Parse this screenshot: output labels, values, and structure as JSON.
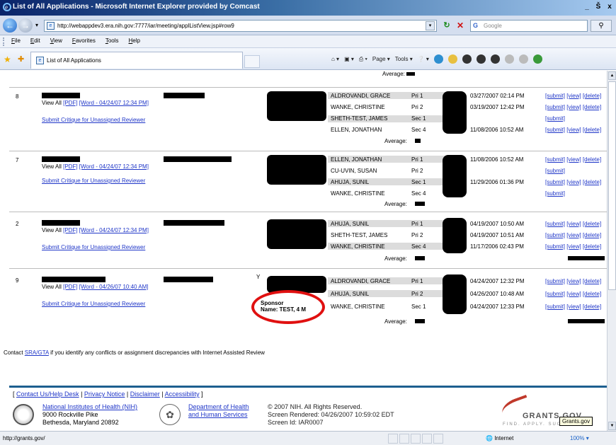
{
  "window": {
    "title": "List of All Applications - Microsoft Internet Explorer provided by Comcast",
    "min": "_",
    "max": "Š",
    "close": "x"
  },
  "address": {
    "url": "http://webappdev3.era.nih.gov:7777/iar/meeting/applListView.jsp#row9",
    "search_placeholder": "Google"
  },
  "menu": [
    "File",
    "Edit",
    "View",
    "Favorites",
    "Tools",
    "Help"
  ],
  "tab": {
    "label": "List of All Applications"
  },
  "commands": {
    "page": "Page",
    "tools": "Tools"
  },
  "content": {
    "avg_top": "Average:",
    "apps": [
      {
        "num": "8",
        "links": [
          "View All",
          "[PDF]",
          "[Word - 04/24/07 12:34 PM]"
        ],
        "submit": "Submit Critique for Unassigned Reviewer",
        "reviewers": [
          {
            "name": "ALDROVANDI, GRACE",
            "role": "Pri 1",
            "date": "03/27/2007 02:14 PM",
            "actions": [
              "[submit]",
              "[view]",
              "[delete]"
            ]
          },
          {
            "name": "WANKE, CHRISTINE",
            "role": "Pri 2",
            "date": "03/19/2007 12:42 PM",
            "actions": [
              "[submit]",
              "[view]",
              "[delete]"
            ]
          },
          {
            "name": "SHETH-TEST, JAMES",
            "role": "Sec 1",
            "date": "",
            "actions": [
              "[submit]"
            ]
          },
          {
            "name": "ELLEN, JONATHAN",
            "role": "Sec 4",
            "date": "11/08/2006 10:52 AM",
            "actions": [
              "[submit]",
              "[view]",
              "[delete]"
            ]
          }
        ],
        "avg": "Average:"
      },
      {
        "num": "7",
        "links": [
          "View All",
          "[PDF]",
          "[Word - 04/24/07 12:34 PM]"
        ],
        "submit": "Submit Critique for Unassigned Reviewer",
        "reviewers": [
          {
            "name": "ELLEN, JONATHAN",
            "role": "Pri 1",
            "date": "11/08/2006 10:52 AM",
            "actions": [
              "[submit]",
              "[view]",
              "[delete]"
            ]
          },
          {
            "name": "CU-UVIN, SUSAN",
            "role": "Pri 2",
            "date": "",
            "actions": [
              "[submit]"
            ]
          },
          {
            "name": "AHUJA, SUNIL",
            "role": "Sec 1",
            "date": "11/29/2006 01:36 PM",
            "actions": [
              "[submit]",
              "[view]",
              "[delete]"
            ]
          },
          {
            "name": "WANKE, CHRISTINE",
            "role": "Sec 4",
            "date": "",
            "actions": [
              "[submit]"
            ]
          }
        ],
        "avg": "Average:"
      },
      {
        "num": "2",
        "links": [
          "View All",
          "[PDF]",
          "[Word - 04/24/07 12:34 PM]"
        ],
        "submit": "Submit Critique for Unassigned Reviewer",
        "reviewers": [
          {
            "name": "AHUJA, SUNIL",
            "role": "Pri 1",
            "date": "04/19/2007 10:50 AM",
            "actions": [
              "[submit]",
              "[view]",
              "[delete]"
            ]
          },
          {
            "name": "SHETH-TEST, JAMES",
            "role": "Pri 2",
            "date": "04/19/2007 10:51 AM",
            "actions": [
              "[submit]",
              "[view]",
              "[delete]"
            ]
          },
          {
            "name": "WANKE, CHRISTINE",
            "role": "Sec 4",
            "date": "11/17/2006 02:43 PM",
            "actions": [
              "[submit]",
              "[view]",
              "[delete]"
            ]
          }
        ],
        "avg": "Average:"
      },
      {
        "num": "9",
        "links": [
          "View All",
          "[PDF]",
          "[Word - 04/26/07 10:40 AM]"
        ],
        "submit": "Submit Critique for Unassigned Reviewer",
        "ycheck": "Y",
        "sponsor": [
          "Sponsor",
          "Name: TEST, 4 M"
        ],
        "reviewers": [
          {
            "name": "ALDROVANDI, GRACE",
            "role": "Pri 1",
            "date": "04/24/2007 12:32 PM",
            "actions": [
              "[submit]",
              "[view]",
              "[delete]"
            ]
          },
          {
            "name": "AHUJA, SUNIL",
            "role": "Pri 2",
            "date": "04/26/2007 10:48 AM",
            "actions": [
              "[submit]",
              "[view]",
              "[delete]"
            ]
          },
          {
            "name": "WANKE, CHRISTINE",
            "role": "Sec 1",
            "date": "04/24/2007 12:33 PM",
            "actions": [
              "[submit]",
              "[view]",
              "[delete]"
            ]
          }
        ],
        "avg": "Average:"
      }
    ],
    "contact": {
      "pre": "Contact ",
      "link": "SRA/GTA",
      "post": " if you identify any conflicts or assignment discrepancies with Internet Assisted Review"
    }
  },
  "footer": {
    "links": [
      "Contact Us/Help Desk",
      "Privacy Notice",
      "Disclaimer",
      "Accessibility"
    ],
    "nih": {
      "name": "National Institutes of Health (NIH)",
      "addr1": "9000 Rockville Pike",
      "addr2": "Bethesda, Maryland 20892"
    },
    "hhs": {
      "line1": "Department of Health",
      "line2": "and Human Services"
    },
    "copy": {
      "line1": "© 2007 NIH. All Rights Reserved.",
      "line2": "Screen Rendered: 04/26/2007 10:59:02 EDT",
      "line3": "Screen Id: IAR0007"
    },
    "grants": {
      "word": "GRANTS.GOV",
      "tag": "FIND. APPLY. SUCCEED."
    },
    "tooltip": "Grants.gov"
  },
  "status": {
    "url": "http://grants.gov/",
    "zone": "Internet",
    "zoom": "100%"
  }
}
